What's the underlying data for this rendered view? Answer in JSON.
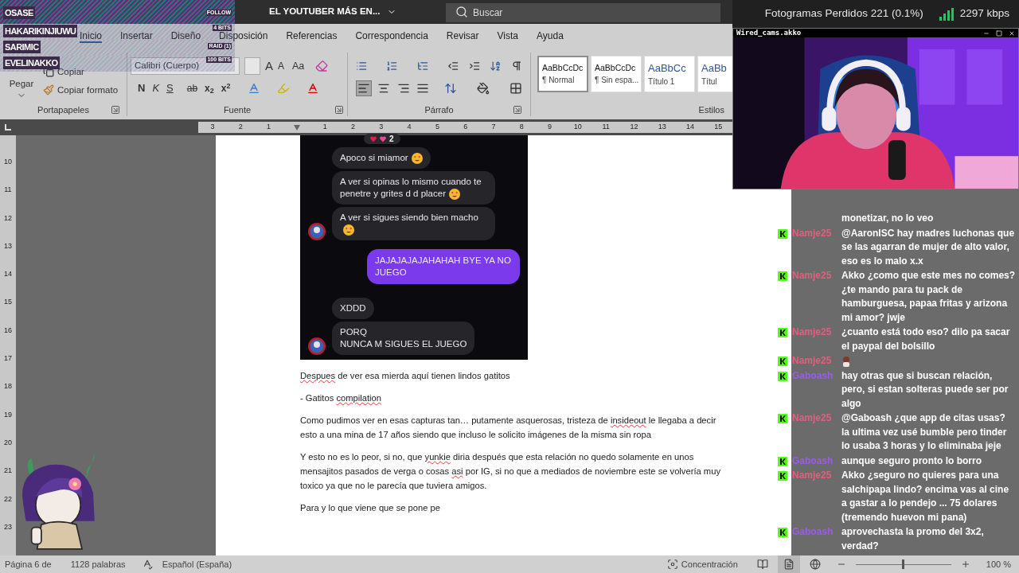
{
  "overlay_alerts": [
    {
      "name": "OSASE",
      "event": "FOLLOW"
    },
    {
      "name": "HAKARIKINJIUWU",
      "event": "4 BITS"
    },
    {
      "name": "SARIMIC",
      "event": "RAID (1)"
    },
    {
      "name": "EVELINAKKO",
      "event": "100 BITS"
    }
  ],
  "title_bar": {
    "document_title": "EL YOUTUBER MÁS EN...",
    "search_placeholder": "Buscar"
  },
  "ribbon_tabs": [
    {
      "label": "Inicio",
      "selected": true
    },
    {
      "label": "Insertar",
      "selected": false
    },
    {
      "label": "Diseño",
      "selected": false
    },
    {
      "label": "Disposición",
      "selected": false
    },
    {
      "label": "Referencias",
      "selected": false
    },
    {
      "label": "Correspondencia",
      "selected": false
    },
    {
      "label": "Revisar",
      "selected": false
    },
    {
      "label": "Vista",
      "selected": false
    },
    {
      "label": "Ayuda",
      "selected": false
    }
  ],
  "ribbon": {
    "clipboard": {
      "paste": "Pegar",
      "copy": "Copiar",
      "format_painter": "Copiar formato",
      "group": "Portapapeles"
    },
    "font": {
      "font_name": "Calibri (Cuerpo)",
      "grow_font": "A",
      "shrink_font": "A",
      "case_button": "Aa",
      "bold": "N",
      "italic": "K",
      "underline": "S",
      "strikethrough": "ab",
      "subscript": "x$_{2}$",
      "superscript": "x$^{2}$",
      "group": "Fuente"
    },
    "paragraph": {
      "group": "Párrafo",
      "alignment": [
        {
          "kind": "left",
          "selected": true
        },
        {
          "kind": "center",
          "selected": false
        },
        {
          "kind": "right",
          "selected": false
        },
        {
          "kind": "justify",
          "selected": false
        }
      ]
    },
    "styles": {
      "group": "Estilos",
      "items": [
        {
          "preview": "AaBbCcDc",
          "label": "¶ Normal",
          "kind": "body",
          "selected": true
        },
        {
          "preview": "AaBbCcDc",
          "label": "¶ Sin espa...",
          "kind": "body",
          "selected": false
        },
        {
          "preview": "AaBbCc",
          "label": "Título 1",
          "kind": "heading",
          "selected": false
        },
        {
          "preview": "AaBb",
          "label": "Títul",
          "kind": "heading",
          "selected": false
        }
      ]
    }
  },
  "ruler": {
    "left": [
      {
        "label": "3"
      },
      {
        "label": "2"
      },
      {
        "label": "1"
      }
    ],
    "right": [
      {
        "label": "1"
      },
      {
        "label": "2"
      },
      {
        "label": "3"
      },
      {
        "label": "4"
      },
      {
        "label": "5"
      },
      {
        "label": "6"
      },
      {
        "label": "7"
      },
      {
        "label": "8"
      },
      {
        "label": "9"
      },
      {
        "label": "10"
      },
      {
        "label": "11"
      },
      {
        "label": "12"
      },
      {
        "label": "13"
      },
      {
        "label": "14"
      },
      {
        "label": "15"
      }
    ],
    "vertical": [
      {
        "label": "10"
      },
      {
        "label": "11"
      },
      {
        "label": "12"
      },
      {
        "label": "13"
      },
      {
        "label": "14"
      },
      {
        "label": "15"
      },
      {
        "label": "16"
      },
      {
        "label": "17"
      },
      {
        "label": "18"
      },
      {
        "label": "19"
      },
      {
        "label": "20"
      },
      {
        "label": "21"
      },
      {
        "label": "22"
      },
      {
        "label": "23"
      }
    ]
  },
  "document": {
    "embedded_chat": {
      "reaction_count": "2",
      "messages": [
        {
          "kind": "received",
          "text": "Apoco si miamor",
          "emoji": true,
          "avatar": false
        },
        {
          "kind": "received",
          "text": "A ver si opinas lo mismo cuando te penetre y grites d d placer",
          "emoji": true,
          "avatar": false
        },
        {
          "kind": "received",
          "text": "A ver si sigues siendo bien macho",
          "emoji": true,
          "avatar": true
        },
        {
          "kind": "sent",
          "text": "JAJAJAJAJAHAHAH BYE YA NO JUEGO"
        },
        {
          "kind": "received",
          "text": "XDDD",
          "emoji": false,
          "avatar": false
        },
        {
          "kind": "received",
          "text": "PORQ\nNUNCA M SIGUES EL JUEGO",
          "emoji": false,
          "avatar": true
        }
      ]
    },
    "paragraphs": [
      [
        {
          "text": "Despues",
          "misspelled": true
        },
        {
          "text": " de ver esa mierda aquí tienen lindos gatitos",
          "misspelled": false
        }
      ],
      [
        {
          "text": "- Gatitos ",
          "misspelled": false
        },
        {
          "text": "compilation",
          "misspelled": true
        }
      ],
      [
        {
          "text": "Como pudimos ver en esas capturas tan… putamente asquerosas, tristeza de ",
          "misspelled": false
        },
        {
          "text": "insideout",
          "misspelled": true
        },
        {
          "text": " le llegaba a decir esto a una mina de 17 años siendo que incluso le solicito imágenes de la misma sin ropa",
          "misspelled": false
        }
      ],
      [
        {
          "text": "Y esto no es lo peor, si no, que ",
          "misspelled": false
        },
        {
          "text": "yunkie",
          "misspelled": true
        },
        {
          "text": " diria después que esta relación no quedo solamente en unos mensajitos pasados de verga o cosas ",
          "misspelled": false
        },
        {
          "text": "asi",
          "misspelled": true
        },
        {
          "text": " por IG, si no que a mediados de noviembre este se volvería muy toxico ya que no le parecía que tuviera amigos.",
          "misspelled": false
        }
      ],
      [
        {
          "text": "Para y lo que viene que se pone pe",
          "misspelled": false
        }
      ]
    ]
  },
  "status_bar": {
    "page": "Página 6 de",
    "words": "1128 palabras",
    "language": "Español (España)",
    "focus": "Concentración",
    "zoom": "100 %",
    "zoom_slider": {
      "level": 0.5
    }
  },
  "stream_stats": {
    "dropped_frames": "Fotogramas Perdidos 221 (0.1%)",
    "bitrate": "2297 kbps"
  },
  "webcam": {
    "title": "Wired_cams.akko"
  },
  "chat": [
    {
      "kind": "text",
      "text": "monetizar, no lo veo"
    },
    {
      "user": "Namje25",
      "color": "#e0607e",
      "kind": "text",
      "text": "@AaronISC hay madres luchonas que se las agarran de mujer de alto valor, eso es lo malo x.x"
    },
    {
      "user": "Namje25",
      "color": "#e0607e",
      "kind": "text",
      "text": "Akko ¿como que este mes no comes? ¿te mando para tu pack de hamburguesa, papaa fritas y arizona mi amor? jwje"
    },
    {
      "user": "Namje25",
      "color": "#e0607e",
      "kind": "text",
      "text": "¿cuanto está todo eso? dilo pa sacar el paypal del bolsillo"
    },
    {
      "user": "Namje25",
      "color": "#e0607e",
      "kind": "emote"
    },
    {
      "user": "Gaboash",
      "color": "#9b5de5",
      "kind": "text",
      "text": "hay otras que si buscan relación, pero, si estan solteras puede ser por algo"
    },
    {
      "user": "Namje25",
      "color": "#e0607e",
      "kind": "text",
      "text": "@Gaboash ¿que app de citas usas? la ultima vez usé bumble pero tinder lo usaba 3 horas y lo eliminaba jeje"
    },
    {
      "user": "Gaboash",
      "color": "#9b5de5",
      "kind": "text",
      "text": "aunque seguro pronto lo borro"
    },
    {
      "user": "Namje25",
      "color": "#e0607e",
      "kind": "text",
      "text": "Akko ¿seguro no quieres para una salchipapa lindo? encima vas al cine a gastar a lo pendejo ... 75 dolares (tremendo huevon mi pana)"
    },
    {
      "user": "Gaboash",
      "color": "#9b5de5",
      "kind": "text",
      "text": "aprovechasta la promo del 3x2, verdad?"
    }
  ]
}
